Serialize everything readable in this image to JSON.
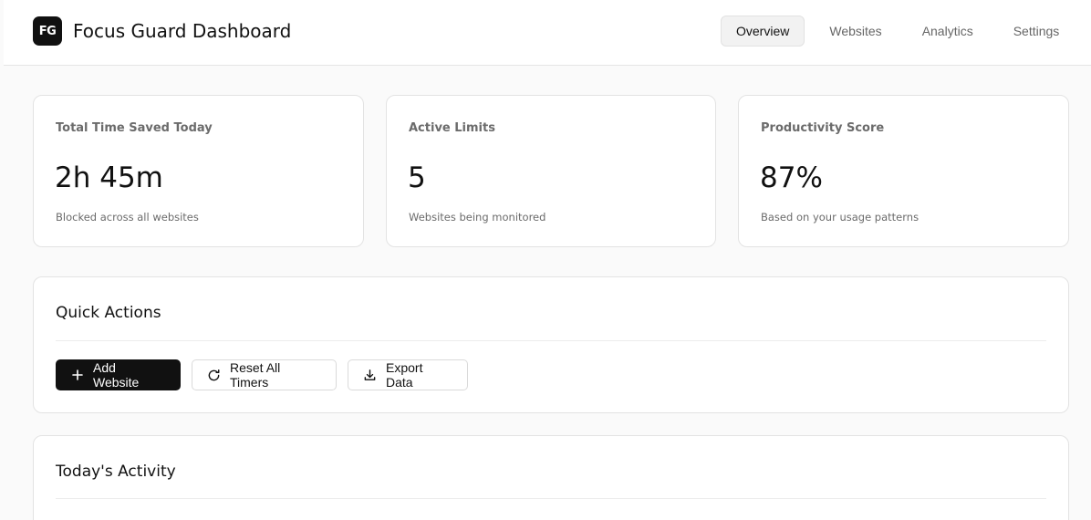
{
  "header": {
    "logo_text": "FG",
    "title": "Focus Guard Dashboard",
    "nav": [
      {
        "label": "Overview",
        "active": true
      },
      {
        "label": "Websites",
        "active": false
      },
      {
        "label": "Analytics",
        "active": false
      },
      {
        "label": "Settings",
        "active": false
      }
    ]
  },
  "stats": [
    {
      "label": "Total Time Saved Today",
      "value": "2h 45m",
      "desc": "Blocked across all websites"
    },
    {
      "label": "Active Limits",
      "value": "5",
      "desc": "Websites being monitored"
    },
    {
      "label": "Productivity Score",
      "value": "87%",
      "desc": "Based on your usage patterns"
    }
  ],
  "quick_actions": {
    "title": "Quick Actions",
    "buttons": [
      {
        "label": "Add Website",
        "icon": "plus-icon"
      },
      {
        "label": "Reset All Timers",
        "icon": "refresh-icon"
      },
      {
        "label": "Export Data",
        "icon": "download-icon"
      }
    ]
  },
  "activity": {
    "title": "Today's Activity"
  },
  "colors": {
    "primary": "#111111",
    "background": "#fafafa",
    "card_border": "#e3e3e3",
    "muted_text": "#6b6b6b"
  }
}
